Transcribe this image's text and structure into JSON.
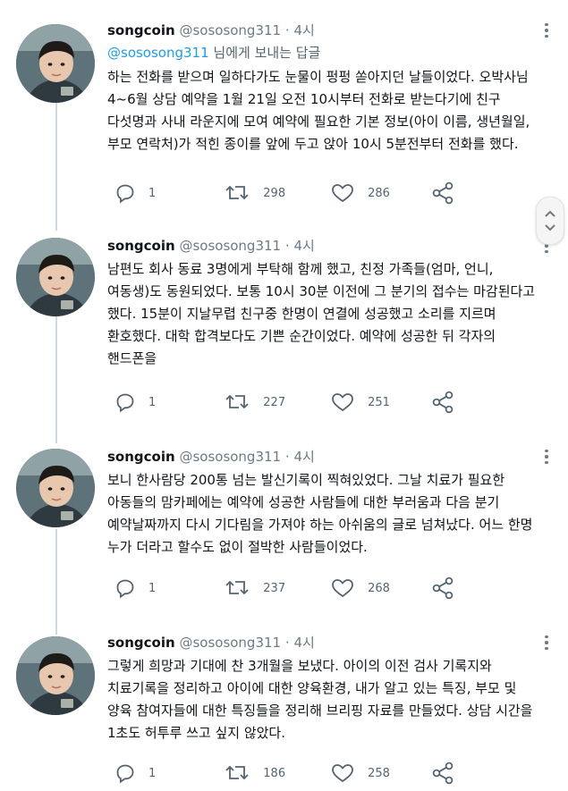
{
  "tweets": [
    {
      "name": "songcoin",
      "handle": "@sososong311",
      "separator": "·",
      "time": "4시",
      "reply_to": {
        "mention": "@sososong311",
        "suffix": " 님에게 보내는 답글"
      },
      "text": "하는 전화를 받으며 일하다가도 눈물이 펑펑 쏟아지던 날들이었다. 오박사님\n4~6월 상담 예약을 1월 21일 오전 10시부터 전화로 받는다기에 친구\n다섯명과 사내 라운지에 모여 예약에 필요한 기본 정보(아이 이름, 생년월일,\n부모 연락처)가 적힌 종이를 앞에 두고 앉아 10시 5분전부터 전화를 했다.",
      "replies": "1",
      "retweets": "298",
      "likes": "286"
    },
    {
      "name": "songcoin",
      "handle": "@sososong311",
      "separator": "·",
      "time": "4시",
      "text": "남편도 회사 동료 3명에게 부탁해 함께 했고, 친정 가족들(엄마, 언니,\n여동생)도 동원되었다. 보통 10시 30분 이전에 그 분기의 접수는 마감된다고\n했다. 15분이 지날무렵 친구중 한명이 연결에 성공했고 소리를 지르며\n환호했다. 대학 합격보다도 기쁜 순간이었다. 예약에 성공한 뒤 각자의\n핸드폰을",
      "replies": "1",
      "retweets": "227",
      "likes": "251"
    },
    {
      "name": "songcoin",
      "handle": "@sososong311",
      "separator": "·",
      "time": "4시",
      "text": "보니 한사람당 200통 넘는 발신기록이 찍혀있었다. 그날 치료가 필요한\n아동들의 맘카페에는 예약에 성공한 사람들에 대한 부러움과 다음 분기\n예약날짜까지 다시 기다림을 가져야 하는 아쉬움의 글로 넘쳐났다. 어느 한명\n누가 더라고 할수도 없이 절박한 사람들이었다.",
      "replies": "1",
      "retweets": "237",
      "likes": "268"
    },
    {
      "name": "songcoin",
      "handle": "@sososong311",
      "separator": "·",
      "time": "4시",
      "text": "그렇게 희망과 기대에 찬 3개월을 보냈다. 아이의 이전 검사 기록지와\n치료기록을 정리하고 아이에 대한 양육환경, 내가 알고 있는 특징, 부모 및\n양육 참여자들에 대한 특징들을 정리해 브리핑 자료를 만들었다. 상담 시간을\n1초도 허투루 쓰고 싶지 않았다.",
      "replies": "1",
      "retweets": "186",
      "likes": "258"
    }
  ],
  "icons": {
    "reply": "comment-bubble-icon",
    "retweet": "retweet-arrows-icon",
    "like": "heart-icon",
    "share": "share-nodes-icon",
    "more": "more-vertical-icon"
  },
  "colors": {
    "mention": "#1d9bf0",
    "muted": "#536471",
    "text": "#0f1419",
    "thread_line": "#cfd9de"
  }
}
